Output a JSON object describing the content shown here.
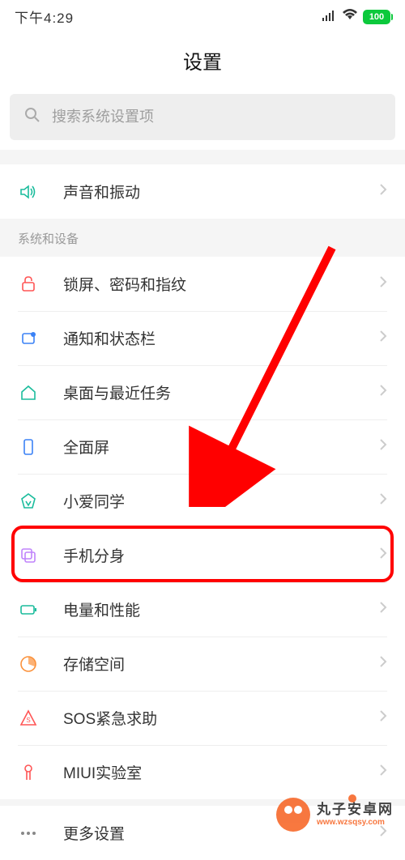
{
  "status": {
    "time": "下午4:29",
    "battery": "100"
  },
  "title": "设置",
  "search": {
    "placeholder": "搜索系统设置项"
  },
  "group_top": {
    "items": [
      {
        "label": "声音和振动"
      }
    ]
  },
  "section_header": "系统和设备",
  "group_main": {
    "items": [
      {
        "label": "锁屏、密码和指纹"
      },
      {
        "label": "通知和状态栏"
      },
      {
        "label": "桌面与最近任务"
      },
      {
        "label": "全面屏"
      },
      {
        "label": "小爱同学"
      },
      {
        "label": "手机分身"
      },
      {
        "label": "电量和性能"
      },
      {
        "label": "存储空间"
      },
      {
        "label": "SOS紧急求助"
      },
      {
        "label": "MIUI实验室"
      }
    ]
  },
  "group_bottom": {
    "items": [
      {
        "label": "更多设置"
      }
    ]
  },
  "watermark": {
    "name": "丸子安卓网",
    "url": "www.wzsqsy.com"
  },
  "annotation": {
    "highlighted_index": 5
  }
}
